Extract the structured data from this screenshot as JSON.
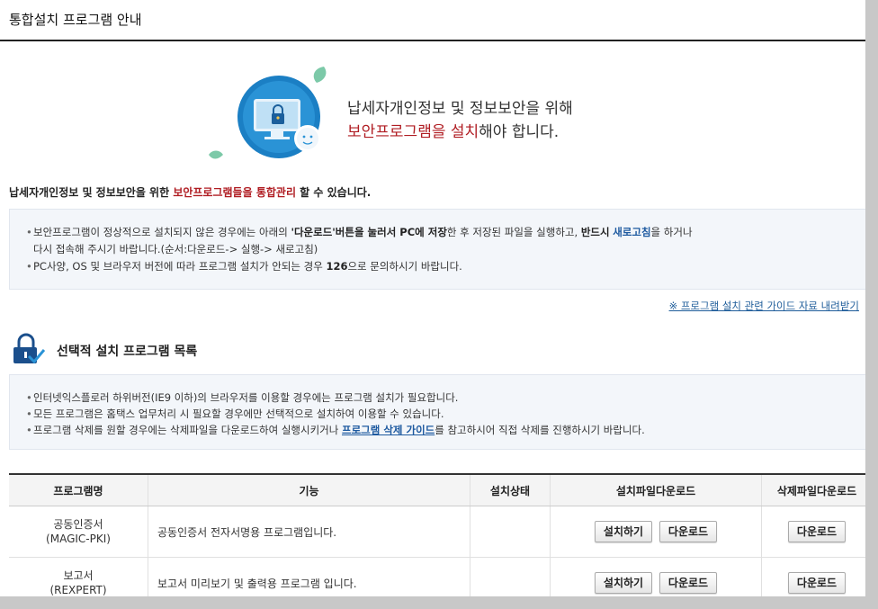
{
  "header": {
    "title": "통합설치 프로그램 안내"
  },
  "hero": {
    "line1": "납세자개인정보 및 정보보안을 위해",
    "line2_red": "보안프로그램을 설치",
    "line2_rest": "해야 합니다."
  },
  "intro": {
    "part1": "납세자개인정보 및 정보보안을 위한 ",
    "red1": "보안프로그램들을",
    "part2": " ",
    "red2": "통합관리",
    "part3": " 할 수 있습니다."
  },
  "notice": {
    "item1_a": "보안프로그램이 정상적으로 설치되지 않은 경우에는 아래의 ",
    "item1_b": "'다운로드'버튼을 눌러서 PC에 저장",
    "item1_c": "한 후 저장된 파일을 실행하고, ",
    "item1_d": "반드시",
    "item1_e": " ",
    "item1_f": "새로고침",
    "item1_g": "을 하거나",
    "item1_cont": "다시 접속해 주시기 바랍니다.(순서:다운로드-> 실행-> 새로고침)",
    "item2_a": "PC사양, OS 및 브라우저 버전에 따라 프로그램 설치가 안되는 경우 ",
    "item2_b": "126",
    "item2_c": "으로 문의하시기 바랍니다."
  },
  "guide_link": "※ 프로그램 설치 관련 가이드 자료 내려받기",
  "section": {
    "title": "선택적 설치 프로그램 목록",
    "icon": "lock-check-icon"
  },
  "notice2": {
    "item1": "인터넷익스플로러 하위버전(IE9 이하)의 브라우저를 이용할 경우에는 프로그램 설치가 필요합니다.",
    "item2": "모든 프로그램은 홈택스 업무처리 시 필요할 경우에만 선택적으로 설치하여 이용할 수 있습니다.",
    "item3_a": "프로그램 삭제를 원할 경우에는 삭제파일을 다운로드하여 실행시키거나 ",
    "item3_link": "프로그램 삭제 가이드",
    "item3_b": "를 참고하시어 직접 삭제를 진행하시기 바랍니다."
  },
  "table": {
    "headers": [
      "프로그램명",
      "기능",
      "설치상태",
      "설치파일다운로드",
      "삭제파일다운로드"
    ],
    "rows": [
      {
        "name": "공동인증서",
        "sub": "(MAGIC-PKI)",
        "func": "공동인증서 전자서명용 프로그램입니다.",
        "status": "",
        "install": "설치하기",
        "download": "다운로드",
        "remove": "다운로드"
      },
      {
        "name": "보고서",
        "sub": "(REXPERT)",
        "func": "보고서 미리보기 및 출력용 프로그램 입니다.",
        "status": "",
        "install": "설치하기",
        "download": "다운로드",
        "remove": "다운로드"
      }
    ]
  },
  "colors": {
    "accent_red": "#b01d23",
    "link_blue": "#1e5aa0",
    "notice_bg": "#f3f6fa"
  }
}
